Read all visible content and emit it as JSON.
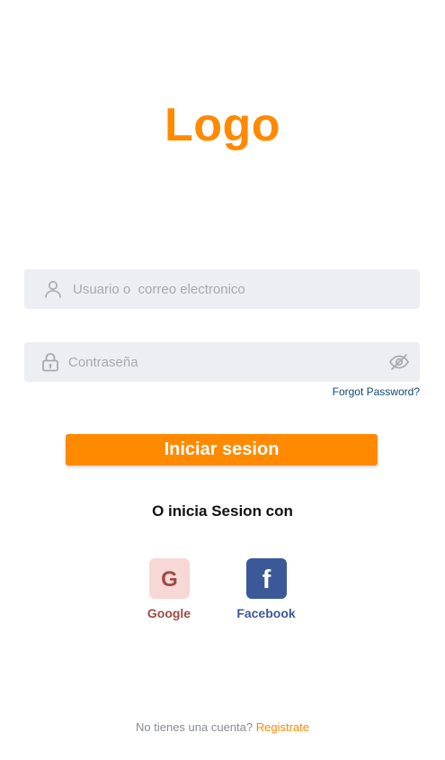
{
  "brand": {
    "logo_text": "Logo",
    "accent_color": "#FF8A00"
  },
  "login_form": {
    "username": {
      "placeholder": "Usuario o  correo electronico",
      "value": "",
      "icon": "user-icon"
    },
    "password": {
      "placeholder": "Contraseña",
      "value": "",
      "icon": "lock-icon",
      "toggle_icon": "eye-off-icon"
    },
    "forgot_password_label": "Forgot Password?",
    "submit_label": "Iniciar sesion"
  },
  "social_login": {
    "title": "O inicia Sesion con",
    "google": {
      "icon_letter": "G",
      "label": "Google",
      "color": "#9A4D45"
    },
    "facebook": {
      "icon_letter": "f",
      "label": "Facebook",
      "color": "#3B5998"
    }
  },
  "signup": {
    "prompt": "No tienes una cuenta?",
    "link_label": "Registrate"
  }
}
